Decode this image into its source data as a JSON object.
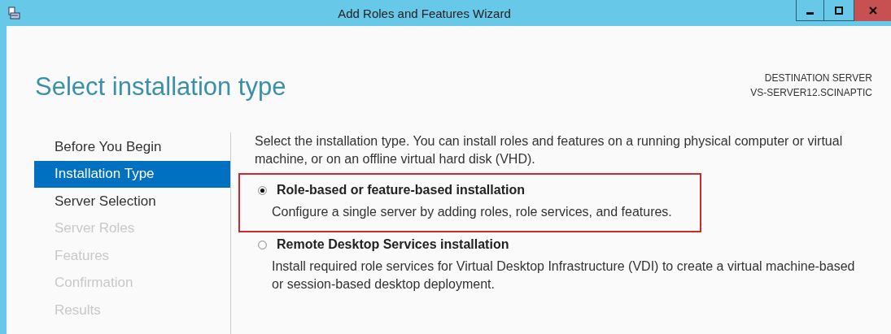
{
  "window": {
    "title": "Add Roles and Features Wizard"
  },
  "page": {
    "heading": "Select installation type",
    "destination_label": "DESTINATION SERVER",
    "destination_server": "VS-SERVER12.SCINAPTIC"
  },
  "sidebar": {
    "items": [
      {
        "label": "Before You Begin",
        "selected": false,
        "disabled": false
      },
      {
        "label": "Installation Type",
        "selected": true,
        "disabled": false
      },
      {
        "label": "Server Selection",
        "selected": false,
        "disabled": false
      },
      {
        "label": "Server Roles",
        "selected": false,
        "disabled": true
      },
      {
        "label": "Features",
        "selected": false,
        "disabled": true
      },
      {
        "label": "Confirmation",
        "selected": false,
        "disabled": true
      },
      {
        "label": "Results",
        "selected": false,
        "disabled": true
      }
    ]
  },
  "content": {
    "intro": "Select the installation type. You can install roles and features on a running physical computer or virtual machine, or on an offline virtual hard disk (VHD).",
    "options": [
      {
        "label": "Role-based or feature-based installation",
        "description": "Configure a single server by adding roles, role services, and features.",
        "selected": true,
        "highlighted": true
      },
      {
        "label": "Remote Desktop Services installation",
        "description": "Install required role services for Virtual Desktop Infrastructure (VDI) to create a virtual machine-based or session-based desktop deployment.",
        "selected": false,
        "highlighted": false
      }
    ]
  }
}
